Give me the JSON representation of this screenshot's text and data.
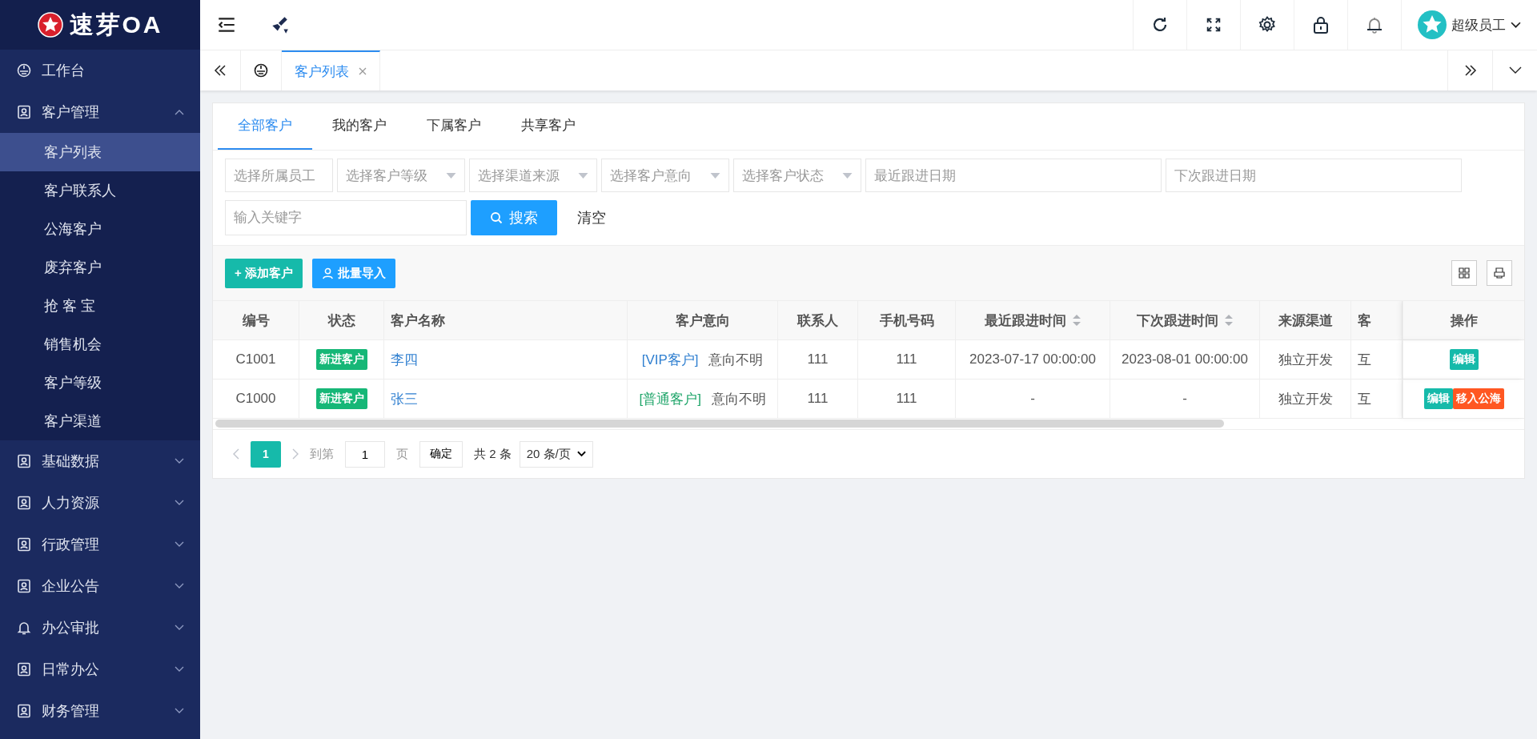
{
  "logo": {
    "text": "速芽OA"
  },
  "sidebar": {
    "items": [
      {
        "label": "工作台"
      },
      {
        "label": "客户管理",
        "expanded": true,
        "children": [
          {
            "label": "客户列表",
            "selected": true
          },
          {
            "label": "客户联系人",
            "selected": false
          },
          {
            "label": "公海客户",
            "selected": false
          },
          {
            "label": "废弃客户",
            "selected": false
          },
          {
            "label": "抢 客 宝",
            "selected": false
          },
          {
            "label": "销售机会",
            "selected": false
          },
          {
            "label": "客户等级",
            "selected": false
          },
          {
            "label": "客户渠道",
            "selected": false
          }
        ]
      },
      {
        "label": "基础数据",
        "expanded": false
      },
      {
        "label": "人力资源",
        "expanded": false
      },
      {
        "label": "行政管理",
        "expanded": false
      },
      {
        "label": "企业公告",
        "expanded": false
      },
      {
        "label": "办公审批",
        "expanded": false
      },
      {
        "label": "日常办公",
        "expanded": false
      },
      {
        "label": "财务管理",
        "expanded": false
      }
    ]
  },
  "header": {
    "user": "超级员工"
  },
  "page_tabs": [
    {
      "label": "客户列表",
      "selected": true
    }
  ],
  "content_tabs": [
    {
      "label": "全部客户",
      "selected": true
    },
    {
      "label": "我的客户",
      "selected": false
    },
    {
      "label": "下属客户",
      "selected": false
    },
    {
      "label": "共享客户",
      "selected": false
    }
  ],
  "filters": [
    {
      "kind": "select",
      "placeholder": "选择所属员工",
      "caret": false
    },
    {
      "kind": "select",
      "placeholder": "选择客户等级",
      "caret": true
    },
    {
      "kind": "select",
      "placeholder": "选择渠道来源",
      "caret": true
    },
    {
      "kind": "select",
      "placeholder": "选择客户意向",
      "caret": true
    },
    {
      "kind": "select",
      "placeholder": "选择客户状态",
      "caret": true
    },
    {
      "kind": "date",
      "placeholder": "最近跟进日期"
    },
    {
      "kind": "date",
      "placeholder": "下次跟进日期"
    }
  ],
  "keyword": {
    "placeholder": "输入关键字"
  },
  "search_button": "搜索",
  "clear_button": "清空",
  "toolbar": {
    "add_button": "+ 添加客户",
    "import_button": "批量导入"
  },
  "table": {
    "columns": [
      {
        "label": "编号",
        "sortable": false
      },
      {
        "label": "状态",
        "sortable": false
      },
      {
        "label": "客户名称",
        "sortable": false
      },
      {
        "label": "客户意向",
        "sortable": false
      },
      {
        "label": "联系人",
        "sortable": false
      },
      {
        "label": "手机号码",
        "sortable": false
      },
      {
        "label": "最近跟进时间",
        "sortable": true
      },
      {
        "label": "下次跟进时间",
        "sortable": true
      },
      {
        "label": "来源渠道",
        "sortable": false
      },
      {
        "label": "客",
        "sortable": false
      },
      {
        "label": "操作",
        "sortable": false
      }
    ],
    "rows": [
      {
        "id": "C1001",
        "status": "新进客户",
        "name": "李四",
        "grade": {
          "label": "[VIP客户]",
          "color": "#2f7fd0"
        },
        "intent": "意向不明",
        "contact": "111",
        "phone": "111",
        "last": "2023-07-17 00:00:00",
        "next": "2023-08-01 00:00:00",
        "source": "独立开发",
        "column_10": "互",
        "actions": [
          {
            "kind": "edit",
            "label": "编辑"
          }
        ]
      },
      {
        "id": "C1000",
        "status": "新进客户",
        "name": "张三",
        "grade": {
          "label": "[普通客户]",
          "color": "#1fa56a"
        },
        "intent": "意向不明",
        "contact": "111",
        "phone": "111",
        "last": "-",
        "next": "-",
        "source": "独立开发",
        "column_10": "互",
        "actions": [
          {
            "kind": "edit",
            "label": "编辑"
          },
          {
            "kind": "move",
            "label": "移入公海"
          }
        ]
      }
    ]
  },
  "pagination": {
    "pages": [
      {
        "label": "1",
        "selected": true
      }
    ],
    "goto_label": "到第",
    "goto_value": "1",
    "page_unit": "页",
    "confirm": "确定",
    "total": "共 2 条",
    "page_size": "20 条/页"
  }
}
